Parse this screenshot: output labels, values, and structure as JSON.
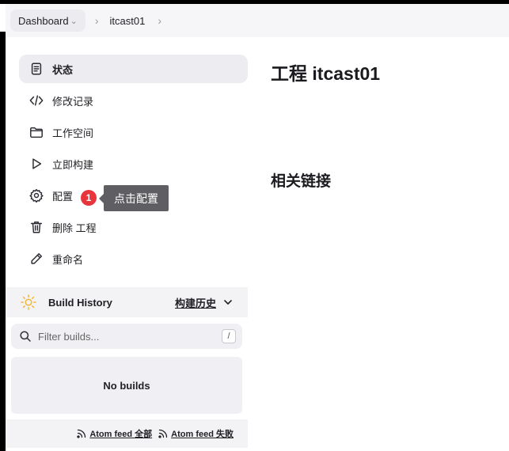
{
  "breadcrumb": {
    "dashboard": "Dashboard",
    "project": "itcast01"
  },
  "nav": {
    "items": [
      {
        "label": "状态",
        "icon": "document-icon"
      },
      {
        "label": "修改记录",
        "icon": "code-icon"
      },
      {
        "label": "工作空间",
        "icon": "folder-icon"
      },
      {
        "label": "立即构建",
        "icon": "play-icon"
      },
      {
        "label": "配置",
        "icon": "gear-icon"
      },
      {
        "label": "删除 工程",
        "icon": "trash-icon"
      },
      {
        "label": "重命名",
        "icon": "pencil-icon"
      }
    ]
  },
  "annotation": {
    "badge": "1",
    "tooltip": "点击配置"
  },
  "build_history": {
    "title": "Build History",
    "trend": "构建历史",
    "filter_placeholder": "Filter builds...",
    "shortcut": "/",
    "empty": "No builds",
    "feed_all": "Atom feed 全部",
    "feed_failed": "Atom feed 失败"
  },
  "main": {
    "title": "工程 itcast01",
    "related_links": "相关链接"
  },
  "colors": {
    "badge": "#e8353b",
    "tooltip_bg": "#5f5f63",
    "sun": "#f5b733"
  }
}
